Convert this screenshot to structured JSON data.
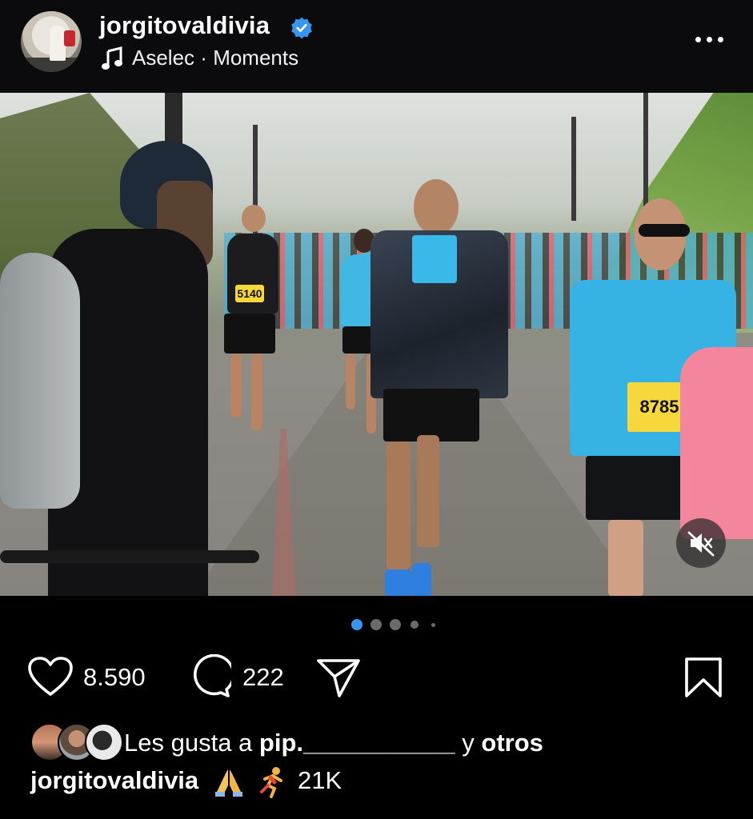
{
  "header": {
    "username": "jorgitovaldivia",
    "verified_icon": "verified-badge-icon",
    "audio": "Aselec",
    "separator": "·",
    "audio_suffix": "Moments",
    "more_icon": "more-horizontal-icon"
  },
  "photo": {
    "bib_main": "5140",
    "bib_right": "8785",
    "mute_icon": "speaker-muted-icon"
  },
  "carousel": {
    "total_dots": 5,
    "active_index": 0
  },
  "actions": {
    "like_count": "8.590",
    "comment_count": "222",
    "icons": [
      "heart-icon",
      "comment-icon",
      "share-icon",
      "save-bookmark-icon"
    ]
  },
  "likes": {
    "prefix": "Les gusta a",
    "user": "pip.___________",
    "connector": "y",
    "others": "otros"
  },
  "caption": {
    "user": "jorgitovaldivia",
    "text": "21K"
  },
  "colors": {
    "verified": "#3797f0",
    "background": "#000000",
    "text": "#ffffff"
  }
}
